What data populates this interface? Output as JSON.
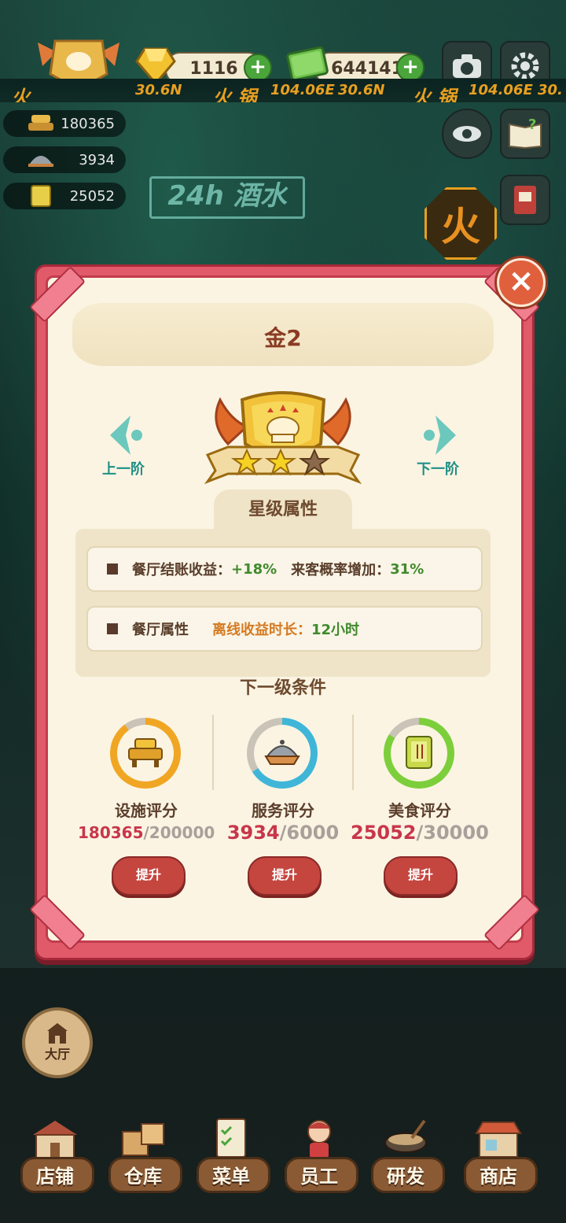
{
  "top": {
    "gems": "1116",
    "cash": "644141",
    "ticker": [
      "火",
      "30.6N",
      "火 锅",
      "104.06E",
      "30.6N",
      "火 锅",
      "104.06E",
      "30."
    ],
    "stats": [
      "180365",
      "3934",
      "25052"
    ]
  },
  "scene": {
    "sign": "24h 酒水",
    "fire_sign": "火"
  },
  "modal": {
    "title": "金2",
    "prev_label": "上一阶",
    "next_label": "下一阶",
    "section": "星级属性",
    "attr1": {
      "label": "餐厅结账收益：",
      "value": "+18%",
      "label2": "来客概率增加：",
      "value2": "31%"
    },
    "attr2": {
      "label": "餐厅属性",
      "label2": "离线收益时长：",
      "value2": "12小时"
    },
    "next_title": "下一级条件",
    "conditions": [
      {
        "label": "设施评分",
        "current": "180365",
        "max": "/200000",
        "progress": 0.9,
        "color": "#f0a623",
        "button": "提升"
      },
      {
        "label": "服务评分",
        "current": "3934",
        "max": "/6000",
        "progress": 0.66,
        "color": "#3fb6d8",
        "button": "提升"
      },
      {
        "label": "美食评分",
        "current": "25052",
        "max": "/30000",
        "progress": 0.84,
        "color": "#7ccf3a",
        "button": "提升"
      }
    ]
  },
  "bottom": {
    "hall": "大厅",
    "nav": [
      "店铺",
      "仓库",
      "菜单",
      "员工",
      "研发",
      "商店"
    ]
  }
}
